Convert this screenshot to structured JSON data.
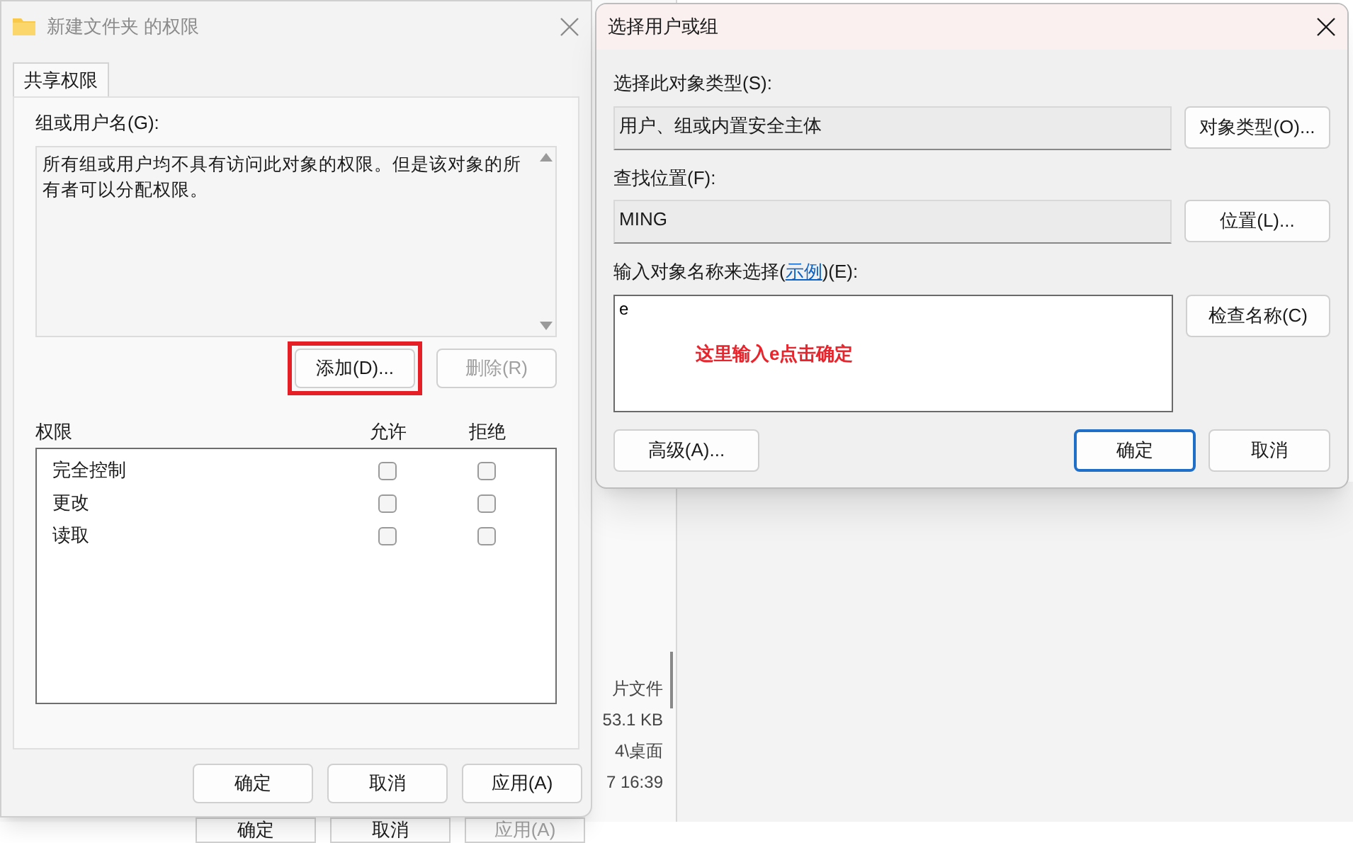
{
  "background_window": {
    "column_texts": [
      "片文件",
      "53.1 KB",
      "4\\桌面",
      "7 16:39"
    ],
    "buttons": [
      {
        "label": "确定",
        "disabled": false
      },
      {
        "label": "取消",
        "disabled": false
      },
      {
        "label": "应用(A)",
        "disabled": true
      }
    ]
  },
  "permissions_dialog": {
    "title": "新建文件夹 的权限",
    "tabs": [
      {
        "label": "共享权限",
        "selected": true
      }
    ],
    "group_label": "组或用户名(G):",
    "group_message": "所有组或用户均不具有访问此对象的权限。但是该对象的所有者可以分配权限。",
    "group_buttons": [
      {
        "label": "添加(D)...",
        "disabled": false,
        "annotated": true
      },
      {
        "label": "删除(R)",
        "disabled": true,
        "annotated": false
      }
    ],
    "permission_columns": [
      "权限",
      "允许",
      "拒绝"
    ],
    "permissions": [
      {
        "name": "完全控制",
        "allow": false,
        "deny": false
      },
      {
        "name": "更改",
        "allow": false,
        "deny": false
      },
      {
        "name": "读取",
        "allow": false,
        "deny": false
      }
    ],
    "footer_buttons": [
      {
        "label": "确定",
        "disabled": false
      },
      {
        "label": "取消",
        "disabled": false
      },
      {
        "label": "应用(A)",
        "disabled": false
      }
    ]
  },
  "select_dialog": {
    "title": "选择用户或组",
    "fields": [
      {
        "label": "选择此对象类型(S):",
        "value": "用户、组或内置安全主体",
        "button": "对象类型(O)..."
      },
      {
        "label": "查找位置(F):",
        "value": "MING",
        "button": "位置(L)..."
      }
    ],
    "names": {
      "label_before": "输入对象名称来选择(",
      "link": "示例",
      "label_after": ")(E):",
      "value": "e",
      "button": "检查名称(C)"
    },
    "annotation": "这里输入e点击确定",
    "advanced_button": "高级(A)...",
    "footer_buttons": [
      {
        "label": "确定",
        "default": true
      },
      {
        "label": "取消",
        "default": false
      }
    ]
  }
}
